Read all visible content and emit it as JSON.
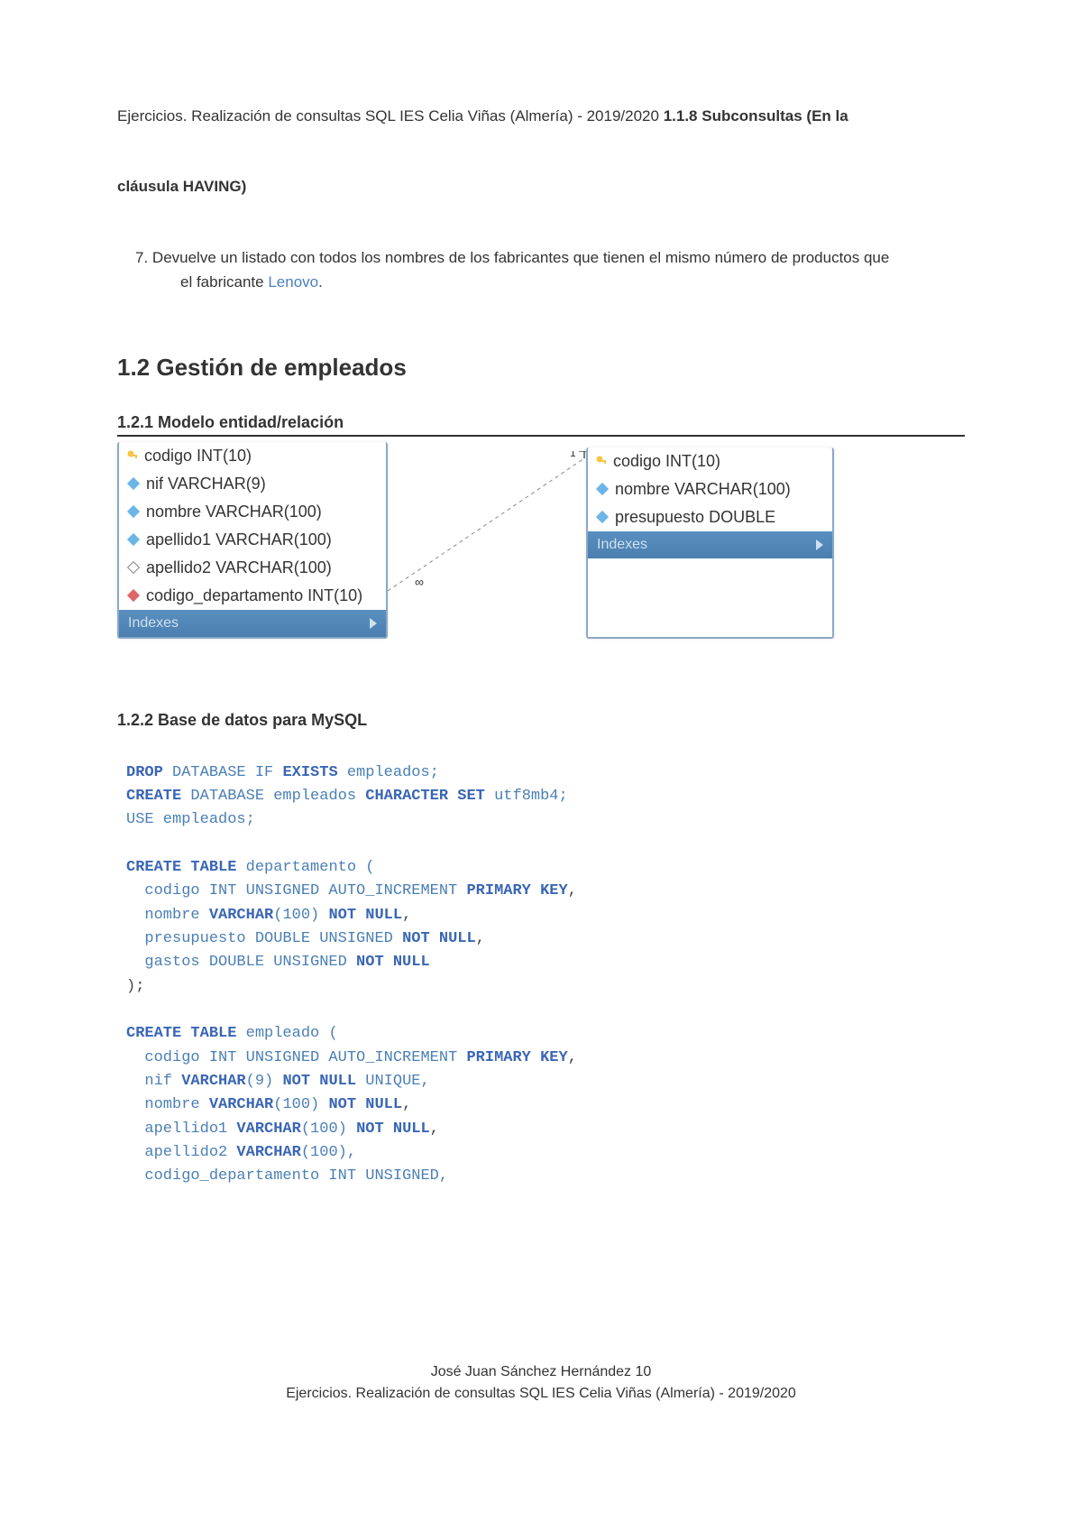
{
  "header": {
    "prefix": "Ejercicios. Realización de consultas SQL IES Celia Viñas (Almería) - 2019/2020 ",
    "section_num": "1.1.8 ",
    "section_title": "Subconsultas (En la"
  },
  "clause": "cláusula HAVING)",
  "list": {
    "num": "7.",
    "text": " Devuelve un listado con todos los nombres de los fabricantes que tienen el mismo número de productos que",
    "cont": "el fabricante ",
    "link": "Lenovo",
    "period": "."
  },
  "h12": "1.2 Gestión de empleados",
  "h121": "1.2.1 Modelo entidad/relación",
  "er": {
    "left": {
      "a0": "codigo INT(10)",
      "a1": "nif VARCHAR(9)",
      "a2": "nombre VARCHAR(100)",
      "a3": "apellido1 VARCHAR(100)",
      "a4": "apellido2 VARCHAR(100)",
      "a5": "codigo_departamento INT(10)",
      "idx": "Indexes"
    },
    "right": {
      "a0": "codigo INT(10)",
      "a1": "nombre VARCHAR(100)",
      "a2": "presupuesto DOUBLE",
      "idx": "Indexes"
    },
    "card1": "∞",
    "card2": "1"
  },
  "h122": "1.2.2 Base de datos para MySQL",
  "code": {
    "l1a": "DROP",
    "l1b": " DATABASE IF ",
    "l1c": "EXISTS",
    "l1d": " empleados;",
    "l2a": "CREATE",
    "l2b": " DATABASE empleados ",
    "l2c": "CHARACTER SET",
    "l2d": " utf8mb4;",
    "l3": "USE empleados;",
    "l5a": "CREATE TABLE",
    "l5b": " departamento (",
    "l6a": "  codigo INT UNSIGNED AUTO_INCREMENT ",
    "l6b": "PRIMARY KEY",
    "l6c": ",",
    "l7a": "  nombre ",
    "l7b": "VARCHAR",
    "l7c": "(100) ",
    "l7d": "NOT NULL",
    "l7e": ",",
    "l8a": "  presupuesto DOUBLE UNSIGNED ",
    "l8b": "NOT NULL",
    "l8c": ",",
    "l9a": "  gastos DOUBLE UNSIGNED ",
    "l9b": "NOT NULL",
    "l10": ");",
    "l12a": "CREATE TABLE",
    "l12b": " empleado (",
    "l13a": "  codigo INT UNSIGNED AUTO_INCREMENT ",
    "l13b": "PRIMARY KEY",
    "l13c": ",",
    "l14a": "  nif ",
    "l14b": "VARCHAR",
    "l14c": "(9) ",
    "l14d": "NOT NULL",
    "l14e": " UNIQUE,",
    "l15a": "  nombre ",
    "l15b": "VARCHAR",
    "l15c": "(100) ",
    "l15d": "NOT NULL",
    "l15e": ",",
    "l16a": "  apellido1 ",
    "l16b": "VARCHAR",
    "l16c": "(100) ",
    "l16d": "NOT NULL",
    "l16e": ",",
    "l17a": "  apellido2 ",
    "l17b": "VARCHAR",
    "l17c": "(100),",
    "l18a": "  codigo_departamento INT UNSIGNED,"
  },
  "footer": {
    "line1": "José Juan Sánchez Hernández 10",
    "line2": "Ejercicios. Realización de consultas SQL IES Celia Viñas (Almería) - 2019/2020"
  }
}
